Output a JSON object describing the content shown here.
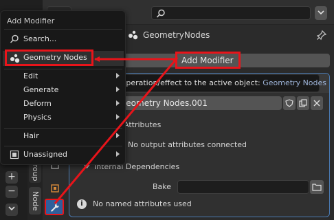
{
  "menu": {
    "title": "Add Modifier",
    "search_label": "Search...",
    "selected_label": "Geometry Nodes",
    "items": [
      {
        "label": "Edit",
        "submenu": true
      },
      {
        "label": "Generate",
        "submenu": true
      },
      {
        "label": "Deform",
        "submenu": true
      },
      {
        "label": "Physics",
        "submenu": true
      },
      {
        "label": "Hair",
        "submenu": true
      },
      {
        "label": "Unassigned",
        "submenu": true
      }
    ]
  },
  "tooltip": {
    "text": "Add a procedural operation/effect to the active object:",
    "highlight": "Geometry Nodes"
  },
  "properties": {
    "context_title": "GeometryNodes",
    "add_modifier_label": "Add Modifier",
    "node_group_name": "Geometry Nodes.001",
    "attributes_label": "Attributes",
    "outputs_text": "No output attributes connected",
    "internal_dependencies_label": "Internal Dependencies",
    "bake_label": "Bake",
    "bake_value": "",
    "info_text": "No named attributes used"
  },
  "tabs": {
    "group": "Group",
    "node": "Node"
  },
  "annotation": {
    "callout_label": "Add Modifier",
    "highlight_color": "#e8141a"
  },
  "colors": {
    "accent": "#4a7bb3",
    "active_tab": "#2f5f9b",
    "tooltip_highlight": "#9db3d8"
  }
}
